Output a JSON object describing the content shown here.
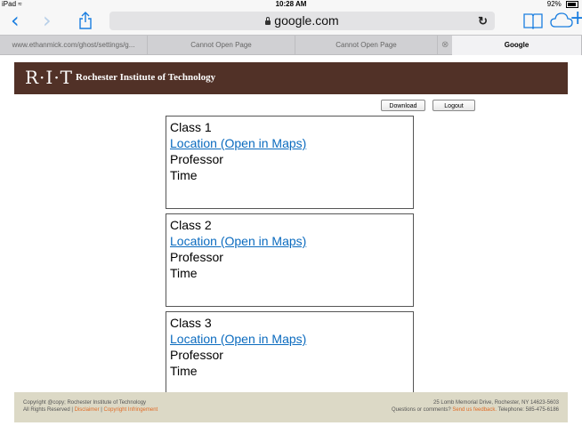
{
  "status": {
    "device": "iPad",
    "time": "10:28 AM",
    "battery": "92%"
  },
  "browser": {
    "address": "google.com",
    "tabs": [
      {
        "label": "www.ethanmick.com/ghost/settings/g...",
        "active": false
      },
      {
        "label": "Cannot Open Page",
        "active": false
      },
      {
        "label": "Cannot Open Page",
        "active": false
      },
      {
        "label": "Google",
        "active": true
      }
    ]
  },
  "header": {
    "logo": "R·I·T",
    "name": "Rochester Institute of Technology",
    "bg_color": "#513127"
  },
  "actions": {
    "download": "Download",
    "logout": "Logout"
  },
  "classes": [
    {
      "name": "Class 1",
      "location": "Location (Open in Maps)",
      "professor": "Professor",
      "time": "Time"
    },
    {
      "name": "Class 2",
      "location": "Location (Open in Maps)",
      "professor": "Professor",
      "time": "Time"
    },
    {
      "name": "Class 3",
      "location": "Location (Open in Maps)",
      "professor": "Professor",
      "time": "Time"
    }
  ],
  "footer": {
    "copyright": "Copyright @copy; Rochester Institute of Technology",
    "rights": "All Rights Reserved |",
    "disclaimer": "Disclaimer",
    "separator": "|",
    "infringement": "Copyright Infringement",
    "address": "25 Lomb Memorial Drive, Rochester, NY 14623-5603",
    "questions": "Questions or comments?",
    "feedback": "Send us feedback.",
    "telephone": "Telephone: 585-475-6186"
  }
}
